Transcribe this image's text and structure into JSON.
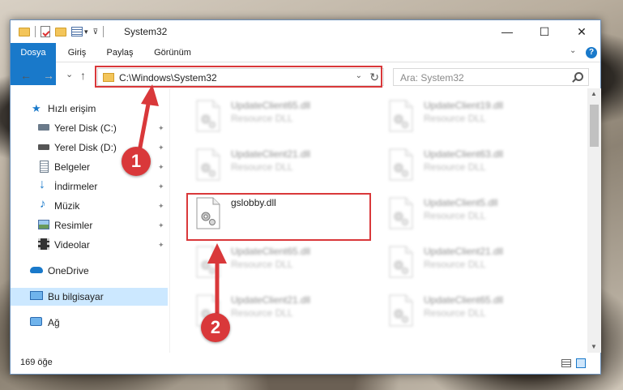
{
  "window": {
    "title": "System32",
    "controls": {
      "minimize": "—",
      "maximize": "☐",
      "close": "✕"
    }
  },
  "ribbon": {
    "tabs": [
      "Dosya",
      "Giriş",
      "Paylaş",
      "Görünüm"
    ],
    "active_tab_color": "#1979ca"
  },
  "nav": {
    "back": "←",
    "forward": "→",
    "recent": "⌄",
    "up": "↑",
    "address": "C:\\Windows\\System32",
    "search_placeholder": "Ara: System32"
  },
  "sidebar": {
    "items": [
      {
        "label": "Hızlı erişim",
        "icon": "star-icon"
      },
      {
        "label": "Yerel Disk (C:)",
        "icon": "drive-icon"
      },
      {
        "label": "Yerel Disk (D:)",
        "icon": "drive-icon"
      },
      {
        "label": "Belgeler",
        "icon": "documents-icon"
      },
      {
        "label": "İndirmeler",
        "icon": "download-icon"
      },
      {
        "label": "Müzik",
        "icon": "music-icon"
      },
      {
        "label": "Resimler",
        "icon": "pictures-icon"
      },
      {
        "label": "Videolar",
        "icon": "video-icon"
      },
      {
        "label": "OneDrive",
        "icon": "onedrive-icon"
      },
      {
        "label": "Bu bilgisayar",
        "icon": "computer-icon"
      },
      {
        "label": "Ağ",
        "icon": "network-icon"
      }
    ],
    "pin_glyph": "📌"
  },
  "files": {
    "left": [
      {
        "name": "UpdateClient65.dll",
        "type": "Resource DLL"
      },
      {
        "name": "UpdateClient21.dll",
        "type": "Resource DLL"
      },
      {
        "name": "gslobby.dll",
        "type": ""
      },
      {
        "name": "UpdateClient65.dll",
        "type": "Resource DLL"
      },
      {
        "name": "UpdateClient21.dll",
        "type": "Resource DLL"
      }
    ],
    "right": [
      {
        "name": "UpdateClient19.dll",
        "type": "Resource DLL"
      },
      {
        "name": "UpdateClient63.dll",
        "type": "Resource DLL"
      },
      {
        "name": "UpdateClient5.dll",
        "type": "Resource DLL"
      },
      {
        "name": "UpdateClient21.dll",
        "type": "Resource DLL"
      },
      {
        "name": "UpdateClient65.dll",
        "type": "Resource DLL"
      }
    ]
  },
  "status": {
    "count": "169 öğe"
  },
  "annotations": {
    "step1": "1",
    "step2": "2",
    "color": "#d9383a"
  }
}
